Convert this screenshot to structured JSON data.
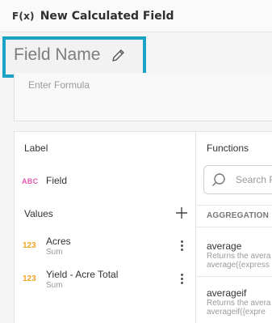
{
  "header": {
    "fx_label": "F(x)",
    "title": "New Calculated Field"
  },
  "name": {
    "label": "Field Name",
    "edit_icon": "pencil-icon"
  },
  "formula": {
    "placeholder": "Enter Formula"
  },
  "fields_panel": {
    "label_header": "Label",
    "label_item": {
      "type_badge": "ABC",
      "name": "Field"
    },
    "values_header": "Values",
    "add_icon": "plus-icon",
    "values": [
      {
        "type_badge": "123",
        "name": "Acres",
        "aggregation": "Sum"
      },
      {
        "type_badge": "123",
        "name": "Yield - Acre Total",
        "aggregation": "Sum"
      }
    ]
  },
  "functions_panel": {
    "header": "Functions",
    "search_placeholder": "Search F",
    "category": "AGGREGATION",
    "functions": [
      {
        "name": "average",
        "desc1": "Returns the avera",
        "desc2": "average({express"
      },
      {
        "name": "averageif",
        "desc1": "Returns the avera",
        "desc2": "averageif({expre"
      }
    ]
  },
  "colors": {
    "highlight": "#1ba3c6",
    "text_badge": "#e35ab4",
    "number_badge": "#f1a423"
  }
}
